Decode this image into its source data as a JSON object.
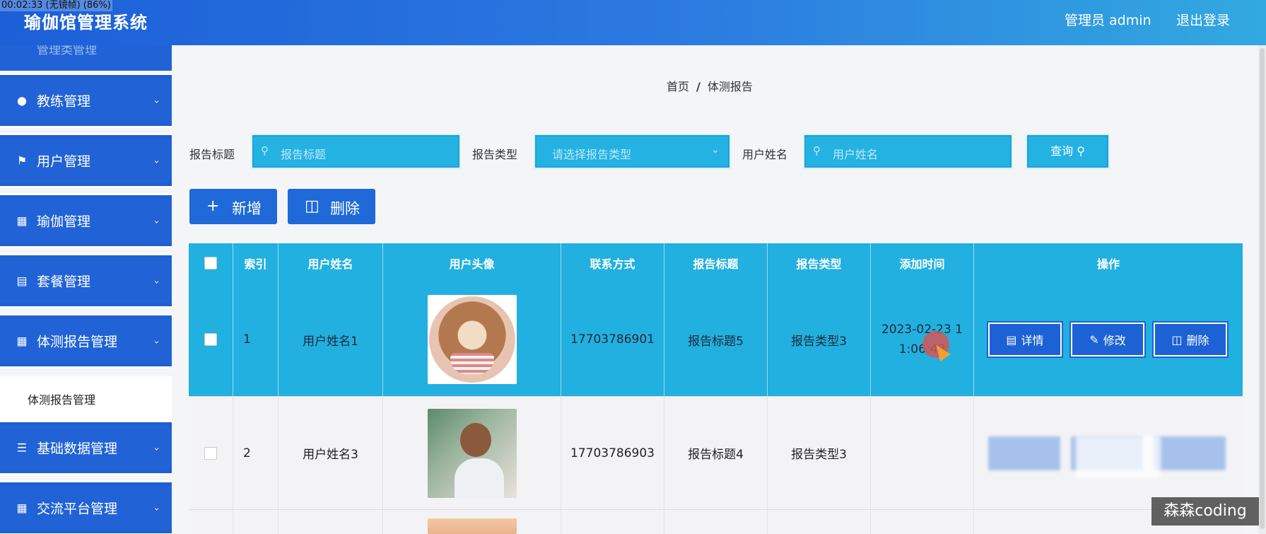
{
  "recording_overlay": "00:02:33 (无镜帧) (86%)",
  "header": {
    "title": "瑜伽馆管理系统",
    "user": "管理员 admin",
    "logout": "退出登录"
  },
  "sidebar": {
    "top_partial": "管理类管理",
    "items": [
      {
        "label": "教练管理",
        "icon": "bulb-icon"
      },
      {
        "label": "用户管理",
        "icon": "flag-icon"
      },
      {
        "label": "瑜伽管理",
        "icon": "briefcase-icon"
      },
      {
        "label": "套餐管理",
        "icon": "clipboard-icon"
      },
      {
        "label": "体测报告管理",
        "icon": "grid-icon"
      },
      {
        "label": "基础数据管理",
        "icon": "sliders-icon"
      },
      {
        "label": "交流平台管理",
        "icon": "grid-icon"
      }
    ],
    "active_sub": "体测报告管理"
  },
  "breadcrumb": {
    "home": "首页",
    "sep": "/",
    "current": "体测报告"
  },
  "filters": {
    "title_label": "报告标题",
    "title_placeholder": "报告标题",
    "type_label": "报告类型",
    "type_placeholder": "请选择报告类型",
    "name_label": "用户姓名",
    "name_placeholder": "用户姓名",
    "query_button": "查询"
  },
  "actions": {
    "add": "新增",
    "delete": "删除"
  },
  "table": {
    "headers": [
      "",
      "索引",
      "用户姓名",
      "用户头像",
      "联系方式",
      "报告标题",
      "报告类型",
      "添加时间",
      "操作"
    ],
    "rows": [
      {
        "index": "1",
        "name": "用户姓名1",
        "phone": "17703786901",
        "title": "报告标题5",
        "type": "报告类型3",
        "time": "2023-02-23 11:06:42"
      },
      {
        "index": "2",
        "name": "用户姓名3",
        "phone": "17703786903",
        "title": "报告标题4",
        "type": "报告类型3",
        "time": ""
      }
    ],
    "row_actions": {
      "detail": "详情",
      "edit": "修改",
      "delete": "删除"
    }
  },
  "watermark": "森森coding",
  "colors": {
    "primary": "#1f6ad8",
    "accent": "#22b0e0",
    "sidebar": "#2163d6"
  }
}
